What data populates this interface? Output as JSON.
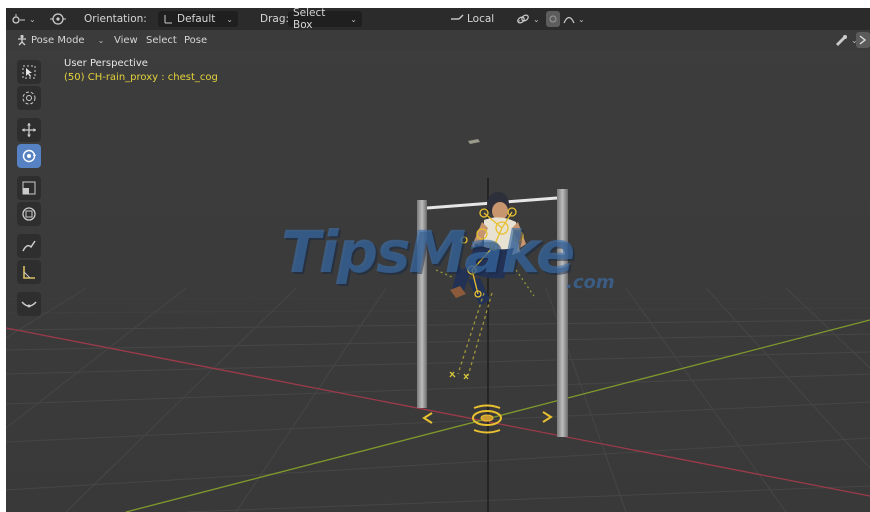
{
  "header": {
    "orientation_label": "Orientation:",
    "orientation_value": "Default",
    "drag_label": "Drag:",
    "drag_value": "Select Box",
    "pivot_value": "Local"
  },
  "modebar": {
    "mode": "Pose Mode",
    "menus": [
      "View",
      "Select",
      "Pose"
    ]
  },
  "viewport": {
    "perspective": "User Perspective",
    "active_object": "(50) CH-rain_proxy : chest_cog"
  },
  "watermark": {
    "main": "TipsMake",
    "sub": ".com"
  },
  "colors": {
    "active_tool": "#5682c4",
    "rig_yellow": "#e8c030",
    "x_axis": "#9c3a4a",
    "y_axis": "#7f9a2c"
  },
  "tools": [
    {
      "name": "select-box-icon",
      "active": false
    },
    {
      "name": "cursor-icon",
      "active": false
    },
    {
      "name": "move-icon",
      "active": false
    },
    {
      "name": "rotate-icon",
      "active": true
    },
    {
      "name": "scale-icon",
      "active": false
    },
    {
      "name": "transform-icon",
      "active": false
    },
    {
      "name": "annotate-icon",
      "active": false
    },
    {
      "name": "measure-icon",
      "active": false
    },
    {
      "name": "relax-pose-icon",
      "active": false
    }
  ]
}
